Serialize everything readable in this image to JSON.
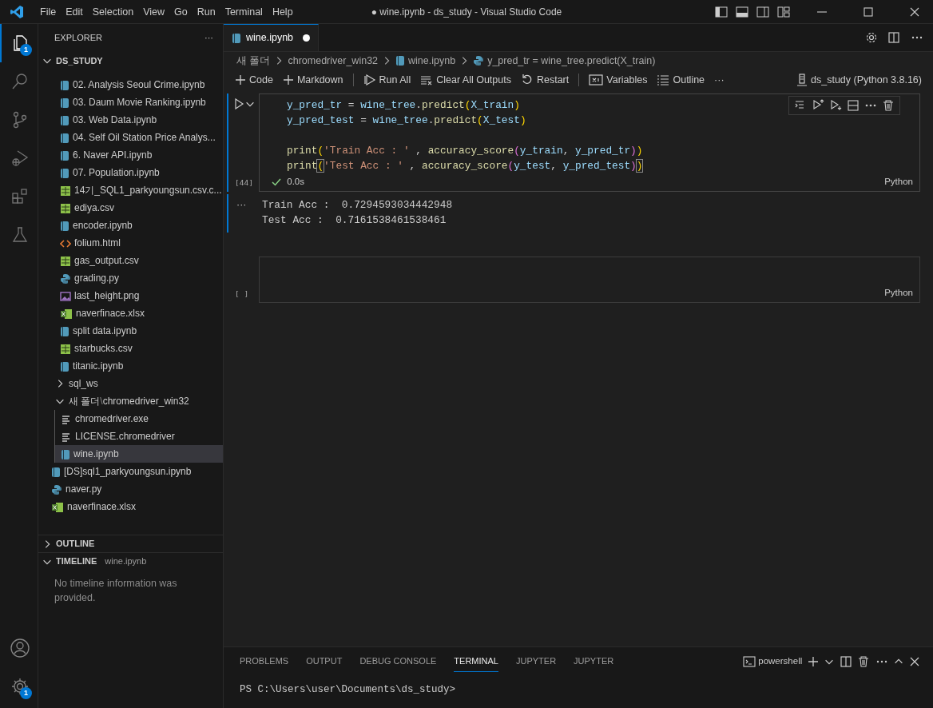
{
  "window": {
    "title": "● wine.ipynb - ds_study - Visual Studio Code"
  },
  "menu": [
    "File",
    "Edit",
    "Selection",
    "View",
    "Go",
    "Run",
    "Terminal",
    "Help"
  ],
  "activity_bar": [
    {
      "kind": "explorer",
      "selected": true,
      "badge": "1"
    },
    {
      "kind": "search",
      "selected": false
    },
    {
      "kind": "source-control",
      "selected": false
    },
    {
      "kind": "run-debug",
      "selected": false
    },
    {
      "kind": "extensions",
      "selected": false
    },
    {
      "kind": "testing",
      "selected": false
    }
  ],
  "activity_bar_bottom": [
    {
      "kind": "account"
    },
    {
      "kind": "settings",
      "badge": "1"
    }
  ],
  "sidebar": {
    "title": "EXPLORER",
    "more": "···",
    "root": "DS_STUDY",
    "files": [
      {
        "kind": "group",
        "children": [
          {
            "label": "02. Analysis Seoul Crime.ipynb",
            "kind": "notebook",
            "selected": false
          },
          {
            "label": "03. Daum Movie Ranking.ipynb",
            "kind": "notebook",
            "selected": false
          },
          {
            "label": "03. Web Data.ipynb",
            "kind": "notebook",
            "selected": false
          },
          {
            "label": "04. Self Oil Station Price Analys...",
            "kind": "notebook",
            "selected": false
          },
          {
            "label": "6. Naver API.ipynb",
            "kind": "notebook",
            "selected": false
          },
          {
            "label": "07. Population.ipynb",
            "kind": "notebook",
            "selected": false
          },
          {
            "label": "14기_SQL1_parkyoungsun.csv.c...",
            "kind": "csv",
            "selected": false
          },
          {
            "label": "ediya.csv",
            "kind": "csv",
            "selected": false
          },
          {
            "label": "encoder.ipynb",
            "kind": "notebook",
            "selected": false
          },
          {
            "label": "folium.html",
            "kind": "html",
            "selected": false
          },
          {
            "label": "gas_output.csv",
            "kind": "csv",
            "selected": false
          },
          {
            "label": "grading.py",
            "kind": "python",
            "selected": false
          },
          {
            "label": "last_height.png",
            "kind": "image",
            "selected": false
          },
          {
            "label": "naverfinace.xlsx",
            "kind": "excel",
            "selected": false
          },
          {
            "label": "split data.ipynb",
            "kind": "notebook",
            "selected": false
          },
          {
            "label": "starbucks.csv",
            "kind": "csv",
            "selected": false
          },
          {
            "label": "titanic.ipynb",
            "kind": "notebook",
            "selected": false
          },
          {
            "label": "sql_ws",
            "kind": "folder",
            "expanded": false,
            "selected": false
          },
          {
            "label": "새 폴더",
            "separator": "\\",
            "label_2": "chromedriver_win32",
            "kind": "folder",
            "expanded": true,
            "selected": false,
            "children": [
              {
                "label": "chromedriver.exe",
                "kind": "text",
                "selected": false
              },
              {
                "label": "LICENSE.chromedriver",
                "kind": "text",
                "selected": false
              },
              {
                "label": "wine.ipynb",
                "kind": "notebook",
                "selected": true
              }
            ]
          }
        ]
      },
      {
        "label": "[DS]sql1_parkyoungsun.ipynb",
        "kind": "notebook",
        "selected": false
      },
      {
        "label": "naver.py",
        "kind": "python",
        "selected": false
      },
      {
        "label": "naverfinace.xlsx",
        "kind": "excel",
        "selected": false
      }
    ],
    "outline": {
      "title": "OUTLINE",
      "expanded": false
    },
    "timeline": {
      "title": "TIMELINE",
      "subtitle": "wine.ipynb",
      "expanded": true,
      "message": "No timeline information was provided."
    }
  },
  "editor": {
    "tabs": [
      {
        "label": "wine.ipynb",
        "selected": true,
        "modified": true
      }
    ],
    "breadcrumb": [
      {
        "label": "새 폴더",
        "kind": "folder"
      },
      {
        "label": "chromedriver_win32",
        "kind": "folder"
      },
      {
        "label": "wine.ipynb",
        "kind": "notebook"
      },
      {
        "label": "y_pred_tr = wine_tree.predict(X_train)",
        "kind": "python"
      }
    ],
    "toolbar": [
      {
        "label": "Code",
        "kind": "add"
      },
      {
        "label": "Markdown",
        "kind": "add"
      },
      {
        "kind": "separator"
      },
      {
        "label": "Run All",
        "kind": "run"
      },
      {
        "label": "Clear All Outputs",
        "kind": "clear"
      },
      {
        "label": "Restart",
        "kind": "restart"
      },
      {
        "kind": "separator"
      },
      {
        "label": "Variables",
        "kind": "variables"
      },
      {
        "label": "Outline",
        "kind": "list"
      },
      {
        "label": "···",
        "kind": "more"
      }
    ],
    "kernel": "ds_study (Python 3.8.16)",
    "cells": [
      {
        "kind": "code",
        "selected": true,
        "execution_count": "[44]",
        "status": "0.0s",
        "succeeded": true,
        "language": "Python",
        "lines": [
          {
            "blank_before": false,
            "matched_brackets": false,
            "tokens": [
              {
                "text": "y_pred_tr",
                "kind": "var"
              },
              {
                "text": " = ",
                "kind": "plain"
              },
              {
                "text": "wine_tree",
                "kind": "var"
              },
              {
                "text": ".",
                "kind": "plain"
              },
              {
                "text": "predict",
                "kind": "func"
              },
              {
                "text": "(",
                "kind": "paren1"
              },
              {
                "text": "X_train",
                "kind": "var"
              },
              {
                "text": ")",
                "kind": "paren1"
              }
            ]
          },
          {
            "blank_before": false,
            "matched_brackets": false,
            "tokens": [
              {
                "text": "y_pred_test",
                "kind": "var"
              },
              {
                "text": " = ",
                "kind": "plain"
              },
              {
                "text": "wine_tree",
                "kind": "var"
              },
              {
                "text": ".",
                "kind": "plain"
              },
              {
                "text": "predict",
                "kind": "func"
              },
              {
                "text": "(",
                "kind": "paren1"
              },
              {
                "text": "X_test",
                "kind": "var"
              },
              {
                "text": ")",
                "kind": "paren1"
              }
            ]
          },
          {
            "blank_before": true,
            "matched_brackets": false,
            "tokens": [
              {
                "text": "print",
                "kind": "func"
              },
              {
                "text": "(",
                "kind": "paren1"
              },
              {
                "text": "'Train Acc : '",
                "kind": "string"
              },
              {
                "text": " , ",
                "kind": "plain"
              },
              {
                "text": "accuracy_score",
                "kind": "func"
              },
              {
                "text": "(",
                "kind": "paren2"
              },
              {
                "text": "y_train",
                "kind": "var"
              },
              {
                "text": ", ",
                "kind": "plain"
              },
              {
                "text": "y_pred_tr",
                "kind": "var"
              },
              {
                "text": ")",
                "kind": "paren2"
              },
              {
                "text": ")",
                "kind": "paren1"
              }
            ]
          },
          {
            "blank_before": false,
            "matched_brackets": true,
            "tokens": [
              {
                "text": "print",
                "kind": "func"
              },
              {
                "text": "(",
                "kind": "paren1"
              },
              {
                "text": "'Test Acc : '",
                "kind": "string"
              },
              {
                "text": " , ",
                "kind": "plain"
              },
              {
                "text": "accuracy_score",
                "kind": "func"
              },
              {
                "text": "(",
                "kind": "paren2"
              },
              {
                "text": "y_test",
                "kind": "var"
              },
              {
                "text": ", ",
                "kind": "plain"
              },
              {
                "text": "y_pred_test",
                "kind": "var"
              },
              {
                "text": ")",
                "kind": "paren2"
              },
              {
                "text": ")",
                "kind": "paren1"
              }
            ]
          }
        ],
        "output_more": "···",
        "output": [
          "Train Acc :  0.7294593034442948",
          "Test Acc :  0.7161538461538461"
        ]
      },
      {
        "kind": "code",
        "selected": false,
        "execution_count": "[ ]",
        "language": "Python"
      }
    ]
  },
  "panel": {
    "tabs": [
      {
        "label": "PROBLEMS",
        "selected": false
      },
      {
        "label": "OUTPUT",
        "selected": false
      },
      {
        "label": "DEBUG CONSOLE",
        "selected": false
      },
      {
        "label": "TERMINAL",
        "selected": true
      },
      {
        "label": "JUPYTER",
        "selected": false
      },
      {
        "label": "JUPYTER",
        "selected": false
      }
    ],
    "shell": "powershell",
    "terminal": "PS C:\\Users\\user\\Documents\\ds_study>"
  }
}
